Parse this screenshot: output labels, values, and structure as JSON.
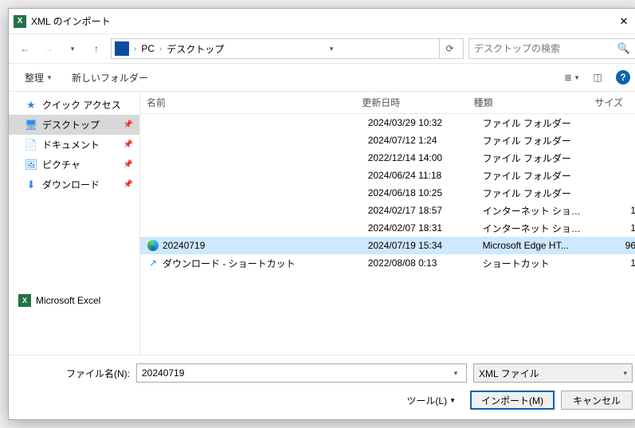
{
  "title": "XML のインポート",
  "breadcrumb": {
    "pc": "PC",
    "desktop": "デスクトップ"
  },
  "search_placeholder": "デスクトップの検索",
  "toolbar": {
    "organize": "整理",
    "newfolder": "新しいフォルダー"
  },
  "nav": {
    "quick": "クイック アクセス",
    "desktop": "デスクトップ",
    "documents": "ドキュメント",
    "pictures": "ピクチャ",
    "downloads": "ダウンロード",
    "excel": "Microsoft Excel"
  },
  "columns": {
    "name": "名前",
    "date": "更新日時",
    "type": "種類",
    "size": "サイズ"
  },
  "rows": [
    {
      "name": "",
      "date": "2024/03/29 10:32",
      "type": "ファイル フォルダー",
      "size": "",
      "icon": "",
      "sel": false
    },
    {
      "name": "",
      "date": "2024/07/12 1:24",
      "type": "ファイル フォルダー",
      "size": "",
      "icon": "",
      "sel": false
    },
    {
      "name": "",
      "date": "2022/12/14 14:00",
      "type": "ファイル フォルダー",
      "size": "",
      "icon": "",
      "sel": false
    },
    {
      "name": "",
      "date": "2024/06/24 11:18",
      "type": "ファイル フォルダー",
      "size": "",
      "icon": "",
      "sel": false
    },
    {
      "name": "",
      "date": "2024/06/18 10:25",
      "type": "ファイル フォルダー",
      "size": "",
      "icon": "",
      "sel": false
    },
    {
      "name": "",
      "date": "2024/02/17 18:57",
      "type": "インターネット ショート...",
      "size": "1",
      "icon": "",
      "sel": false
    },
    {
      "name": "",
      "date": "2024/02/07 18:31",
      "type": "インターネット ショート...",
      "size": "1",
      "icon": "",
      "sel": false
    },
    {
      "name": "20240719",
      "date": "2024/07/19 15:34",
      "type": "Microsoft Edge HT...",
      "size": "96",
      "icon": "edge",
      "sel": true
    },
    {
      "name": "ダウンロード - ショートカット",
      "date": "2022/08/08 0:13",
      "type": "ショートカット",
      "size": "1",
      "icon": "shortcut",
      "sel": false
    }
  ],
  "filename_label": "ファイル名(N):",
  "filename_value": "20240719",
  "filter": "XML ファイル",
  "tools": "ツール(L)",
  "import": "インポート(M)",
  "cancel": "キャンセル"
}
